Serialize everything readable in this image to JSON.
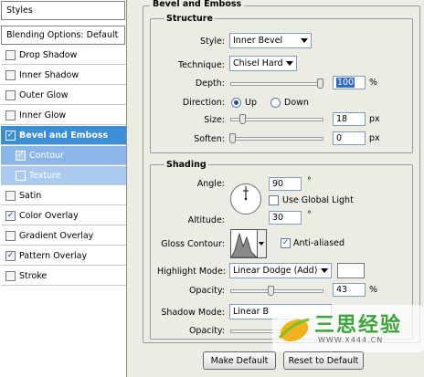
{
  "left_panel": {
    "header": "Styles",
    "blending": "Blending Options: Default",
    "items": [
      {
        "label": "Drop Shadow",
        "checked": false
      },
      {
        "label": "Inner Shadow",
        "checked": false
      },
      {
        "label": "Outer Glow",
        "checked": false
      },
      {
        "label": "Inner Glow",
        "checked": false
      },
      {
        "label": "Bevel and Emboss",
        "checked": true
      },
      {
        "label": "Contour",
        "checked": true
      },
      {
        "label": "Texture",
        "checked": false
      },
      {
        "label": "Satin",
        "checked": false
      },
      {
        "label": "Color Overlay",
        "checked": true
      },
      {
        "label": "Gradient Overlay",
        "checked": false
      },
      {
        "label": "Pattern Overlay",
        "checked": true
      },
      {
        "label": "Stroke",
        "checked": false
      }
    ],
    "check_mark": "✓"
  },
  "bevel": {
    "title": "Bevel and Emboss",
    "structure": {
      "title": "Structure",
      "style_label": "Style:",
      "style_value": "Inner Bevel",
      "technique_label": "Technique:",
      "technique_value": "Chisel Hard",
      "depth_label": "Depth:",
      "depth_value": "100",
      "depth_unit": "%",
      "direction_label": "Direction:",
      "direction_up": "Up",
      "direction_down": "Down",
      "size_label": "Size:",
      "size_value": "18",
      "size_unit": "px",
      "soften_label": "Soften:",
      "soften_value": "0",
      "soften_unit": "px"
    },
    "shading": {
      "title": "Shading",
      "angle_label": "Angle:",
      "angle_value": "90",
      "angle_unit": "°",
      "global_light_label": "Use Global Light",
      "altitude_label": "Altitude:",
      "altitude_value": "30",
      "altitude_unit": "°",
      "gloss_label": "Gloss Contour:",
      "anti_aliased_label": "Anti-aliased",
      "highlight_mode_label": "Highlight Mode:",
      "highlight_mode_value": "Linear Dodge (Add)",
      "highlight_color": "#ffffff",
      "opacity_label": "Opacity:",
      "highlight_opacity": "43",
      "opacity_unit": "%",
      "shadow_mode_label": "Shadow Mode:",
      "shadow_mode_value": "Linear B",
      "shadow_opacity_label": "Opacity:"
    },
    "buttons": {
      "make_default": "Make Default",
      "reset_default": "Reset to Default"
    }
  },
  "watermark": {
    "text": "三思经验",
    "url": "WWW.X444.CN"
  },
  "colors": {
    "selected_row": "#3b8dd8",
    "sub_row": "#aacbef",
    "panel_bg": "#ecebe4"
  }
}
